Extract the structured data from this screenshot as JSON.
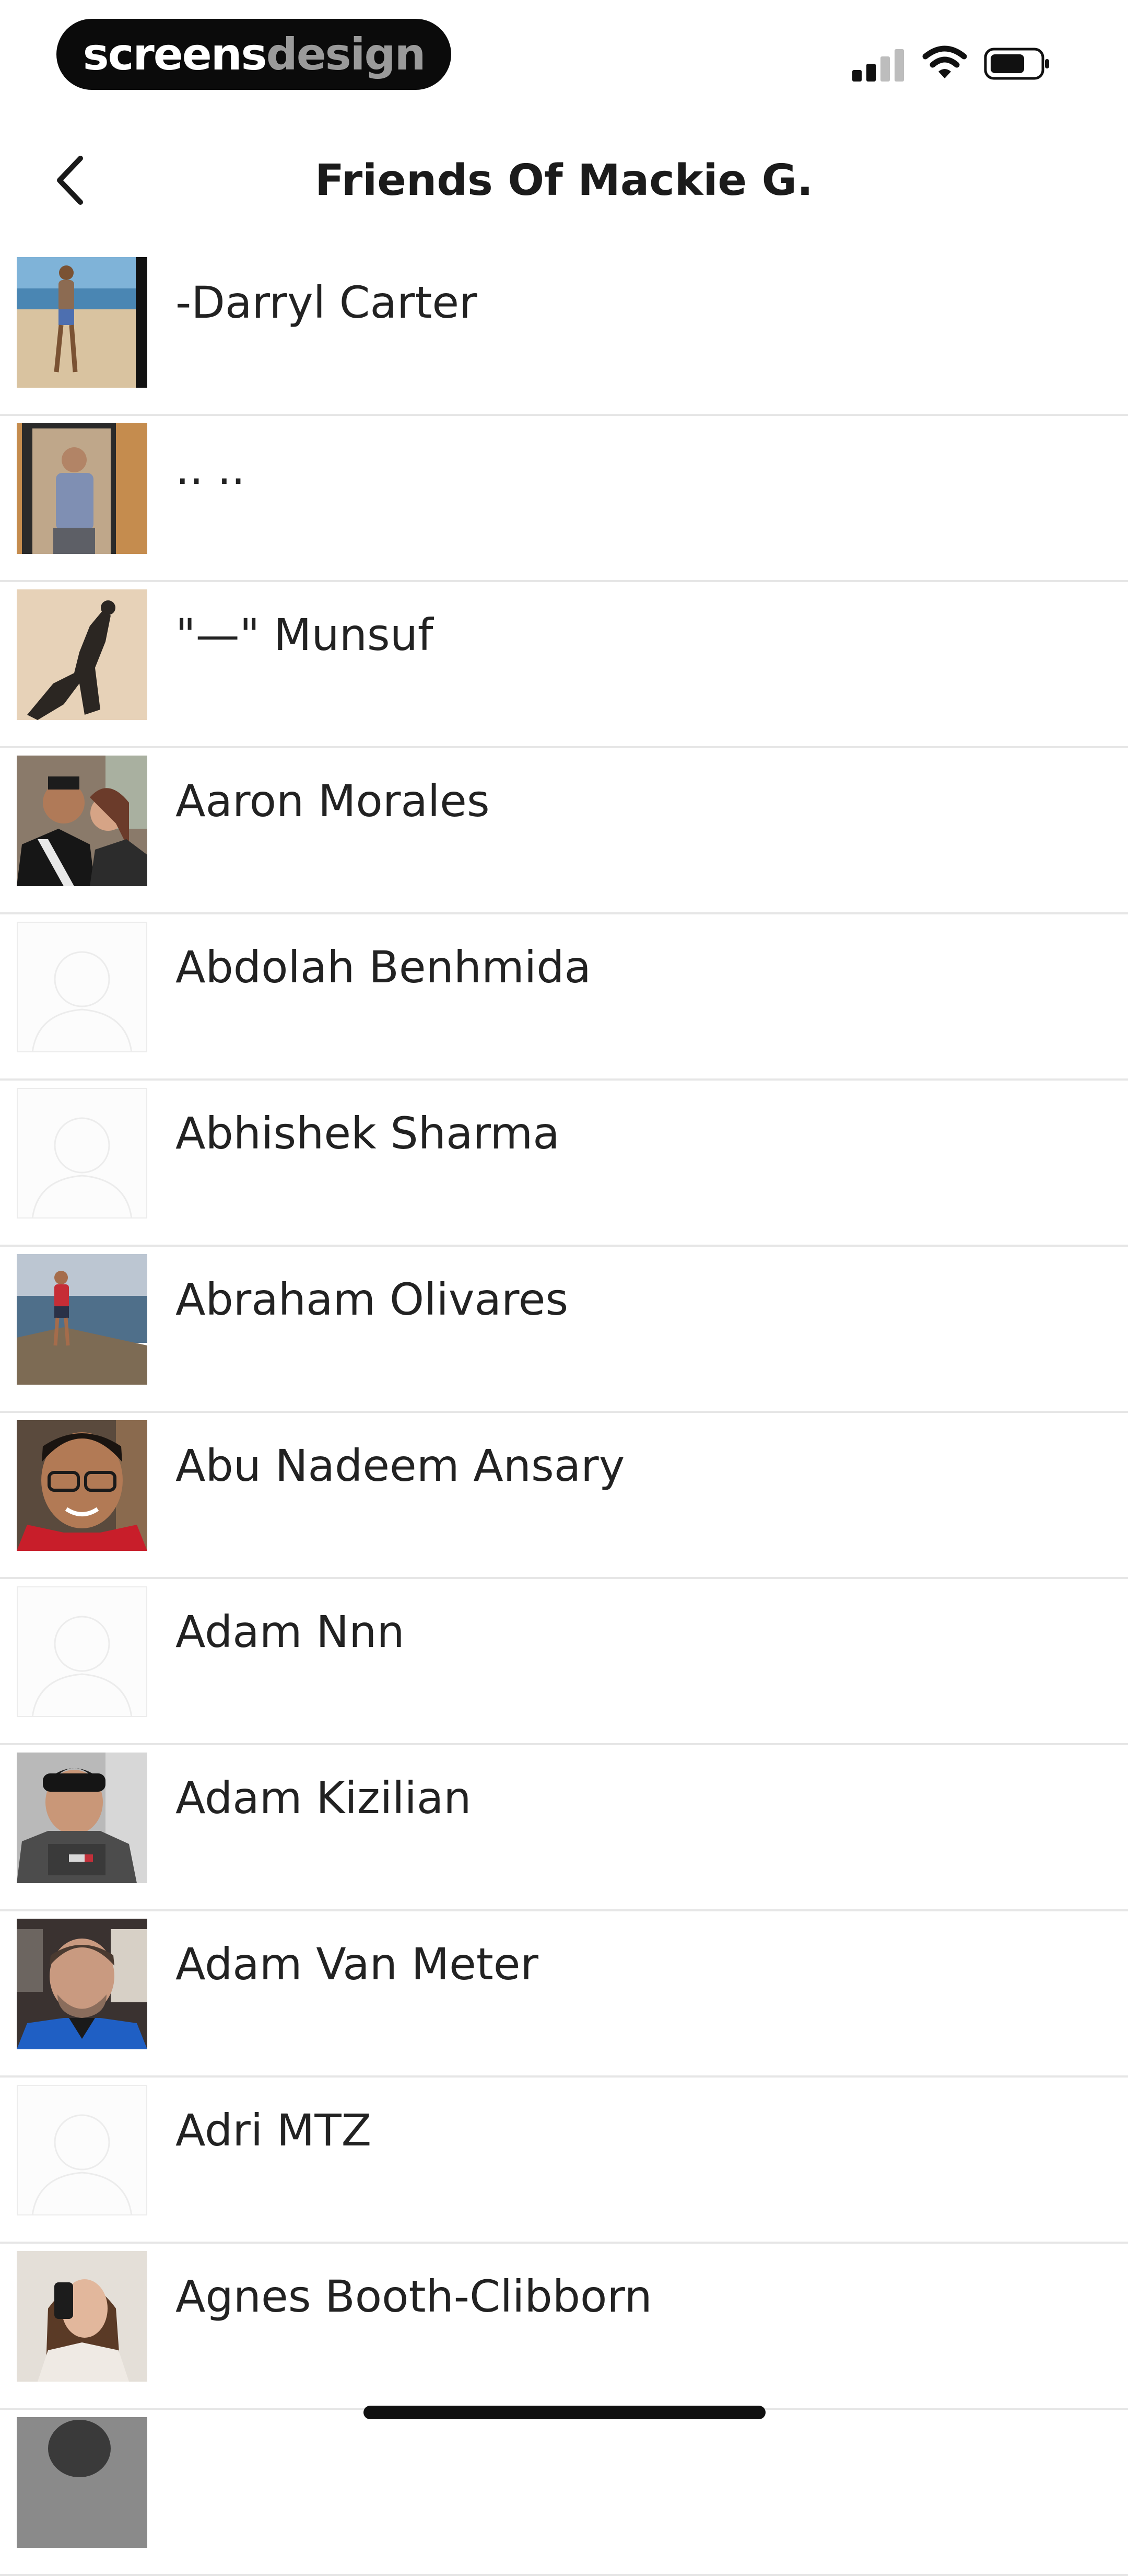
{
  "status_bar": {
    "brand_primary": "screens",
    "brand_secondary": "design",
    "signal_icon": "cellular-signal-icon",
    "wifi_icon": "wifi-icon",
    "battery_icon": "battery-icon"
  },
  "header": {
    "title": "Friends Of Mackie G.",
    "back_icon": "chevron-left-icon"
  },
  "friends": [
    {
      "name": "-Darryl Carter",
      "avatar": "photo"
    },
    {
      "name": ".. ..",
      "avatar": "photo"
    },
    {
      "name": "\"—\" Munsuf",
      "avatar": "photo"
    },
    {
      "name": "Aaron Morales",
      "avatar": "photo"
    },
    {
      "name": "Abdolah Benhmida",
      "avatar": "placeholder"
    },
    {
      "name": "Abhishek Sharma",
      "avatar": "placeholder"
    },
    {
      "name": "Abraham Olivares",
      "avatar": "photo"
    },
    {
      "name": "Abu Nadeem Ansary",
      "avatar": "photo"
    },
    {
      "name": "Adam Nnn",
      "avatar": "placeholder"
    },
    {
      "name": "Adam Kizilian",
      "avatar": "photo"
    },
    {
      "name": "Adam Van Meter",
      "avatar": "photo"
    },
    {
      "name": "Adri MTZ",
      "avatar": "placeholder"
    },
    {
      "name": "Agnes Booth-Clibborn",
      "avatar": "photo"
    },
    {
      "name": "",
      "avatar": "photo"
    }
  ],
  "colors": {
    "background": "#ffffff",
    "text": "#222222",
    "divider": "#e6e6e6",
    "brand_pill": "#0b0b0b"
  }
}
